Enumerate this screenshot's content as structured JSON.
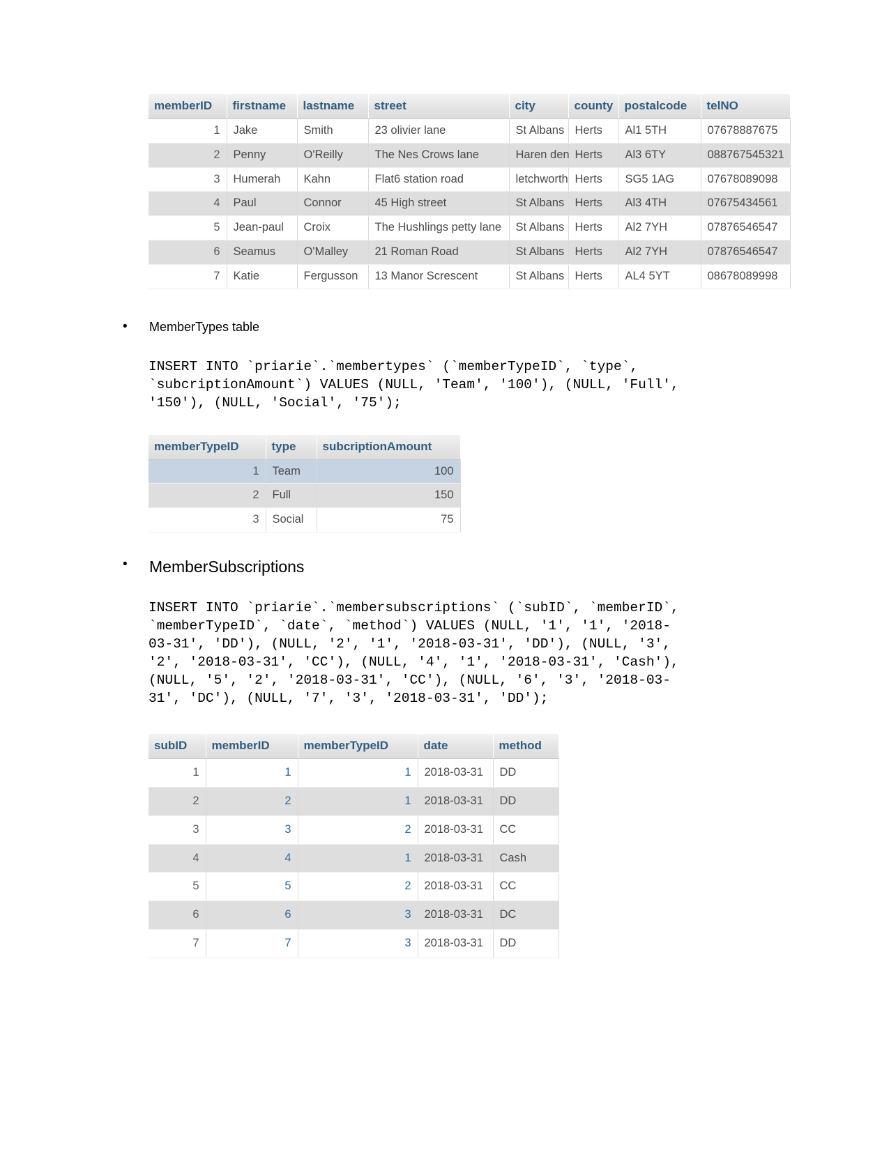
{
  "members_table": {
    "name": "members-result-grid",
    "headers": [
      "memberID",
      "firstname",
      "lastname",
      "street",
      "city",
      "county",
      "postalcode",
      "telNO"
    ],
    "rows": [
      [
        "1",
        "Jake",
        "Smith",
        "23 olivier lane",
        "St Albans",
        "Herts",
        "Al1 5TH",
        "07678887675"
      ],
      [
        "2",
        "Penny",
        "O'Reilly",
        "The Nes Crows lane",
        "Haren den",
        "Herts",
        "Al3 6TY",
        "088767545321"
      ],
      [
        "3",
        "Humerah",
        "Kahn",
        "Flat6 station road",
        "letchworth",
        "Herts",
        "SG5 1AG",
        "07678089098"
      ],
      [
        "4",
        "Paul",
        "Connor",
        "45 High street",
        "St Albans",
        "Herts",
        "Al3 4TH",
        "07675434561"
      ],
      [
        "5",
        "Jean-paul",
        "Croix",
        "The Hushlings petty lane",
        "St Albans",
        "Herts",
        "Al2 7YH",
        "07876546547"
      ],
      [
        "6",
        "Seamus",
        "O'Malley",
        "21 Roman Road",
        "St Albans",
        "Herts",
        "Al2 7YH",
        "07876546547"
      ],
      [
        "7",
        "Katie",
        "Fergusson",
        "13 Manor Screscent",
        "St Albans",
        "Herts",
        "AL4 5YT",
        "08678089998"
      ]
    ]
  },
  "section_membertypes": {
    "bullet_label": "MemberTypes table",
    "sql": "INSERT INTO `priarie`.`membertypes` (`memberTypeID`, `type`,\n`subcriptionAmount`) VALUES (NULL, 'Team', '100'), (NULL, 'Full',\n'150'), (NULL, 'Social', '75');",
    "table": {
      "headers": [
        "memberTypeID",
        "type",
        "subcriptionAmount"
      ],
      "rows": [
        [
          "1",
          "Team",
          "100"
        ],
        [
          "2",
          "Full",
          "150"
        ],
        [
          "3",
          "Social",
          "75"
        ]
      ]
    }
  },
  "section_membersubscriptions": {
    "bullet_label": "MemberSubscriptions",
    "sql": "INSERT INTO `priarie`.`membersubscriptions` (`subID`, `memberID`,\n`memberTypeID`, `date`, `method`) VALUES (NULL, '1', '1', '2018-\n03-31', 'DD'), (NULL, '2', '1', '2018-03-31', 'DD'), (NULL, '3',\n'2', '2018-03-31', 'CC'), (NULL, '4', '1', '2018-03-31', 'Cash'),\n(NULL, '5', '2', '2018-03-31', 'CC'), (NULL, '6', '3', '2018-03-\n31', 'DC'), (NULL, '7', '3', '2018-03-31', 'DD');",
    "table": {
      "headers": [
        "subID",
        "memberID",
        "memberTypeID",
        "date",
        "method"
      ],
      "rows": [
        [
          "1",
          "1",
          "1",
          "2018-03-31",
          "DD"
        ],
        [
          "2",
          "2",
          "1",
          "2018-03-31",
          "DD"
        ],
        [
          "3",
          "3",
          "2",
          "2018-03-31",
          "CC"
        ],
        [
          "4",
          "4",
          "1",
          "2018-03-31",
          "Cash"
        ],
        [
          "5",
          "5",
          "2",
          "2018-03-31",
          "CC"
        ],
        [
          "6",
          "6",
          "3",
          "2018-03-31",
          "DC"
        ],
        [
          "7",
          "7",
          "3",
          "2018-03-31",
          "DD"
        ]
      ]
    }
  },
  "colors": {
    "header_text": "#315d80",
    "key_value": "#2c6ca0",
    "row_alt": "#dedede",
    "row_highlight": "#c5d3e2",
    "body_text": "#4a4a4a"
  },
  "bullet_glyph": "•"
}
